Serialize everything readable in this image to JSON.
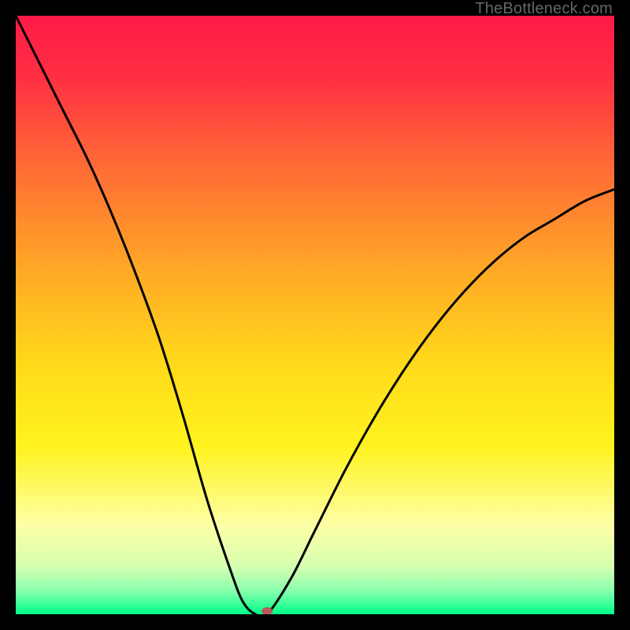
{
  "watermark": "TheBottleneck.com",
  "chart_data": {
    "type": "line",
    "title": "",
    "xlabel": "",
    "ylabel": "",
    "xlim": [
      0,
      100
    ],
    "ylim": [
      0,
      100
    ],
    "background_gradient": {
      "stops": [
        {
          "offset": 0.0,
          "color": "#ff1a47"
        },
        {
          "offset": 0.1,
          "color": "#ff2e42"
        },
        {
          "offset": 0.25,
          "color": "#ff6a36"
        },
        {
          "offset": 0.42,
          "color": "#ffa726"
        },
        {
          "offset": 0.58,
          "color": "#ffd91a"
        },
        {
          "offset": 0.72,
          "color": "#fff31e"
        },
        {
          "offset": 0.85,
          "color": "#fdffa6"
        },
        {
          "offset": 0.92,
          "color": "#d6ffb0"
        },
        {
          "offset": 0.96,
          "color": "#8affae"
        },
        {
          "offset": 1.0,
          "color": "#00ff88"
        }
      ]
    },
    "series": [
      {
        "name": "bottleneck-curve",
        "x": [
          0,
          4,
          8,
          12,
          16,
          20,
          24,
          28,
          32,
          36,
          38,
          40,
          42,
          46,
          50,
          55,
          60,
          65,
          70,
          75,
          80,
          85,
          90,
          95,
          100
        ],
        "y": [
          100,
          92,
          84,
          76,
          67,
          57,
          46,
          33,
          19,
          7,
          2,
          0,
          0,
          6,
          14,
          24,
          33,
          41,
          48,
          54,
          59,
          63,
          66,
          69,
          71
        ]
      }
    ],
    "marker": {
      "x": 42,
      "y": 0,
      "color": "#b65a5a"
    }
  }
}
